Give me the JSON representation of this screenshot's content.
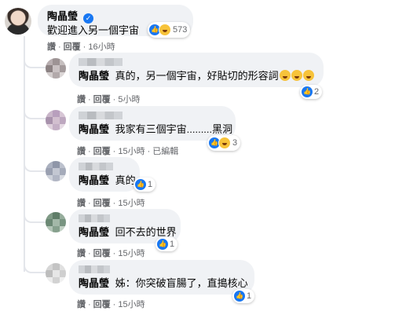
{
  "post": {
    "author": "陶晶瑩",
    "text": "歡迎進入另一個宇宙",
    "reaction_count": "573",
    "actions": {
      "like": "讚",
      "reply": "回覆",
      "time": "16小時"
    }
  },
  "replies": [
    {
      "author": "陶晶瑩",
      "prefix": "真的，另一個宇宙，好貼切的形容詞",
      "reaction_count": "2",
      "actions": {
        "like": "讚",
        "reply": "回覆",
        "time": "5小時"
      }
    },
    {
      "author": "陶晶瑩",
      "prefix": "我家有三個宇宙.........黑洞",
      "reaction_count": "3",
      "actions": {
        "like": "讚",
        "reply": "回覆",
        "time": "15小時",
        "edited": "已編輯"
      }
    },
    {
      "author": "陶晶瑩",
      "prefix": "真的",
      "reaction_count": "1",
      "actions": {
        "like": "讚",
        "reply": "回覆",
        "time": "15小時"
      }
    },
    {
      "author": "陶晶瑩",
      "prefix": "回不去的世界",
      "reaction_count": "1",
      "actions": {
        "like": "讚",
        "reply": "回覆",
        "time": "15小時"
      }
    },
    {
      "author": "陶晶瑩",
      "prefix": "姊：你突破盲腸了，直搗核心",
      "reaction_count": "1",
      "actions": {
        "like": "讚",
        "reply": "回覆",
        "time": "15小時"
      }
    }
  ],
  "icons": {
    "verified": "verified-badge-icon",
    "like": "like-reaction-icon",
    "haha": "haha-reaction-icon"
  },
  "colors": {
    "bubble": "#f0f2f5",
    "like": "#1877f2",
    "meta": "#65676b"
  }
}
